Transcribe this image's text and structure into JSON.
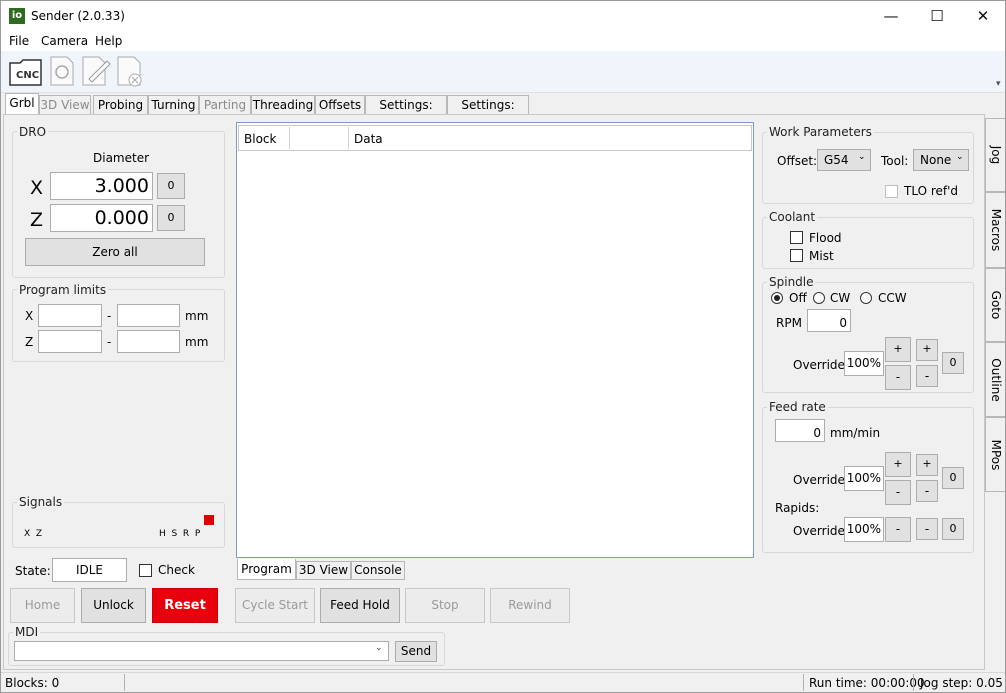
{
  "window": {
    "title": "Sender (2.0.33)",
    "icon_text": "io",
    "minimize": "—",
    "maximize": "☐",
    "close": "✕"
  },
  "menu": [
    "File",
    "Camera",
    "Help"
  ],
  "toolbar": {
    "cnc_label": "CNC"
  },
  "tabs": [
    {
      "label": "Grbl",
      "active": true
    },
    {
      "label": "3D View",
      "disabled": true
    },
    {
      "label": "Probing"
    },
    {
      "label": "Turning"
    },
    {
      "label": "Parting",
      "disabled": true
    },
    {
      "label": "Threading"
    },
    {
      "label": "Offsets"
    },
    {
      "label": "Settings: Grbl"
    },
    {
      "label": "Settings: App"
    }
  ],
  "dro": {
    "title": "DRO",
    "mode": "Diameter",
    "axes": [
      {
        "axis": "X",
        "value": "3.000",
        "zero": "0"
      },
      {
        "axis": "Z",
        "value": "0.000",
        "zero": "0"
      }
    ],
    "zero_all": "Zero all"
  },
  "limits": {
    "title": "Program limits",
    "rows": [
      {
        "axis": "X",
        "dash": "-",
        "unit": "mm"
      },
      {
        "axis": "Z",
        "dash": "-",
        "unit": "mm"
      }
    ]
  },
  "signals": {
    "title": "Signals",
    "left": "X  Z",
    "right": "H  S  R  P",
    "p_color": "#e00000"
  },
  "state": {
    "label": "State:",
    "value": "IDLE",
    "check": "Check"
  },
  "buttons": {
    "home": "Home",
    "unlock": "Unlock",
    "reset": "Reset",
    "cycle_start": "Cycle Start",
    "feed_hold": "Feed Hold",
    "stop": "Stop",
    "rewind": "Rewind"
  },
  "mdi": {
    "title": "MDI",
    "send": "Send",
    "value": ""
  },
  "program": {
    "columns": [
      "Block",
      "",
      "Data"
    ],
    "tabs": [
      "Program",
      "3D View",
      "Console"
    ]
  },
  "work": {
    "title": "Work Parameters",
    "offset_label": "Offset:",
    "offset_value": "G54",
    "tool_label": "Tool:",
    "tool_value": "None",
    "tlo": "TLO ref'd"
  },
  "coolant": {
    "title": "Coolant",
    "flood": "Flood",
    "mist": "Mist"
  },
  "spindle": {
    "title": "Spindle",
    "off": "Off",
    "cw": "CW",
    "ccw": "CCW",
    "rpm_label": "RPM",
    "rpm": "0",
    "override_label": "Override",
    "override": "100%",
    "plus": "+",
    "minus": "-",
    "zero": "0"
  },
  "feed": {
    "title": "Feed rate",
    "value": "0",
    "unit": "mm/min",
    "override_label": "Override",
    "override": "100%",
    "plus": "+",
    "minus": "-",
    "zero": "0",
    "rapids_label": "Rapids:",
    "rapids_override": "100%"
  },
  "side_tabs": [
    "Jog",
    "Macros",
    "Goto",
    "Outline",
    "MPos"
  ],
  "status": {
    "blocks": "Blocks: 0",
    "runtime": "Run time: 00:00:00",
    "jogstep": "Jog step: 0.05"
  },
  "colors": {
    "reset": "#e8000d",
    "icon_green": "#2e6b1e"
  }
}
